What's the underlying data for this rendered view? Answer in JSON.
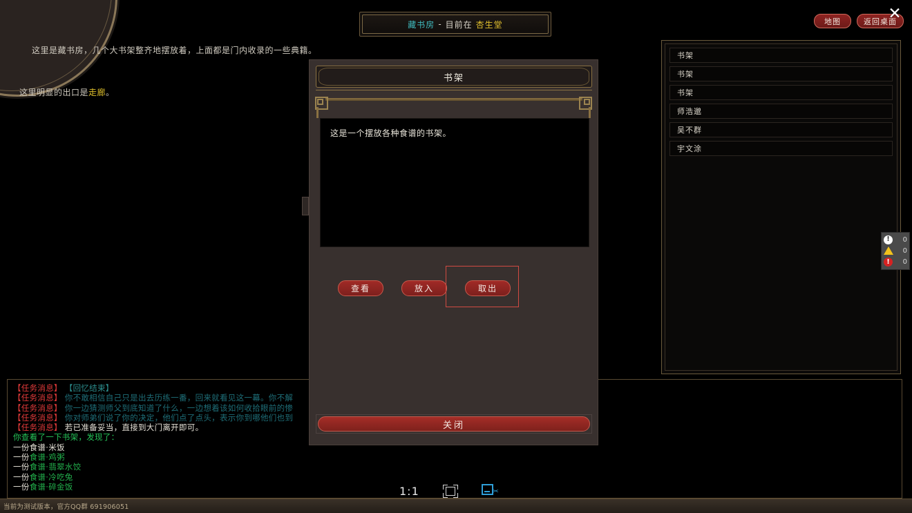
{
  "window": {
    "title": {
      "room": "藏书房",
      "separator": "-",
      "now_label": "目前在",
      "place": "杏生堂"
    },
    "top_buttons": [
      {
        "name": "map",
        "label": "地图"
      },
      {
        "name": "return-desktop",
        "label": "返回桌面"
      }
    ],
    "close_icon": "✕"
  },
  "scene": {
    "description": "这里是藏书房，几个大书架整齐地摆放着，上面都是门内收录的一些典籍。",
    "exit_prefix": "这里明显的出口是",
    "exit_name": "走廊",
    "exit_suffix": "。"
  },
  "right_panel": {
    "items": [
      {
        "label": "书架"
      },
      {
        "label": "书架"
      },
      {
        "label": "书架"
      },
      {
        "label": "师浩邈"
      },
      {
        "label": "吴不群"
      },
      {
        "label": "宇文涂"
      }
    ]
  },
  "notifications": [
    {
      "icon": "info-icon",
      "glyph": "!",
      "count": "0"
    },
    {
      "icon": "warning-icon",
      "glyph": "",
      "count": "0"
    },
    {
      "icon": "error-icon",
      "glyph": "!",
      "count": "0"
    }
  ],
  "chat_log": {
    "quest_tag": "【任务消息】",
    "lines": [
      {
        "tag": "【任务消息】",
        "text": "【回忆结束】",
        "color": "teal-b"
      },
      {
        "tag": "【任务消息】",
        "text": "你不敢相信自己只是出去历练一番，回来就看见这一幕。你不解",
        "color": "teal"
      },
      {
        "tag": "【任务消息】",
        "text": "你一边猜测师父到底知道了什么，一边想着该如何收拾眼前的惨",
        "color": "teal"
      },
      {
        "tag": "【任务消息】",
        "text": "你对师弟们说了你的决定，他们点了点头，表示你到哪他们也到",
        "color": "teal"
      },
      {
        "tag": "【任务消息】",
        "text": "若已准备妥当，直接到大门离开即可。",
        "color": "white"
      }
    ],
    "found_header": "你查看了一下书架，发现了：",
    "found_items": [
      {
        "qty": "一份",
        "kind": "食谱",
        "sep": "·",
        "name": "米饭",
        "kind_color": "white",
        "name_color": "white"
      },
      {
        "qty": "一份",
        "kind": "食谱",
        "sep": "·",
        "name": "鸡粥",
        "kind_color": "green",
        "name_color": "green"
      },
      {
        "qty": "一份",
        "kind": "食谱",
        "sep": "·",
        "name": "翡翠水饺",
        "kind_color": "green",
        "name_color": "green"
      },
      {
        "qty": "一份",
        "kind": "食谱",
        "sep": "·",
        "name": "冷吃兔",
        "kind_color": "green",
        "name_color": "green"
      },
      {
        "qty": "一份",
        "kind": "食谱",
        "sep": "·",
        "name": "碎金饭",
        "kind_color": "green",
        "name_color": "green"
      }
    ]
  },
  "dialog": {
    "title": "书架",
    "description": "这是一个摆放各种食谱的书架。",
    "actions": [
      {
        "name": "view",
        "label": "查看"
      },
      {
        "name": "put-in",
        "label": "放入"
      },
      {
        "name": "take-out",
        "label": "取出"
      }
    ],
    "close_label": "关闭"
  },
  "bottom_bar": {
    "zoom_ratio": "1:1",
    "fit_icon": "crop-icon",
    "snip_icon": "screenshot-icon",
    "version_text": "当前为测试版本，官方QQ群 691906051"
  },
  "colors": {
    "accent_gold": "#8a7142",
    "accent_red": "#a02a26",
    "title_cyan": "#3fb9bd",
    "title_yellow": "#e2c02e",
    "quest_tag_red": "#e23a3a",
    "item_green": "#22b14c",
    "highlight_border": "#d14a42"
  }
}
